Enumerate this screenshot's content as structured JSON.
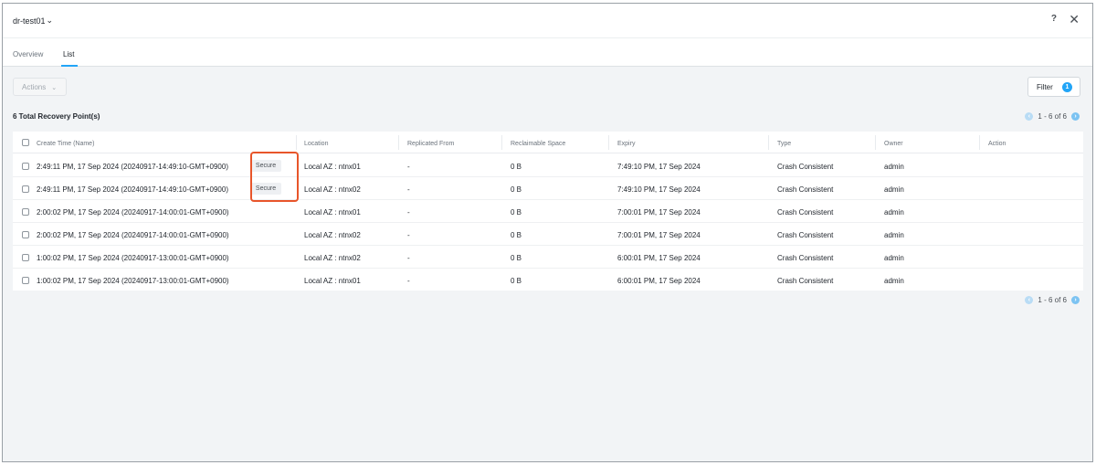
{
  "header": {
    "title": "dr-test01",
    "caret": "⌄",
    "help": "?",
    "close": "✕"
  },
  "tabs": [
    {
      "label": "Overview",
      "active": false
    },
    {
      "label": "List",
      "active": true
    }
  ],
  "toolbar": {
    "actions_label": "Actions",
    "filter_label": "Filter",
    "filter_count": "1"
  },
  "summary": {
    "count_label": "6 Total Recovery Point(s)"
  },
  "pager": {
    "top": "1 - 6 of 6",
    "bottom": "1 - 6 of 6"
  },
  "columns": [
    "Create Time (Name)",
    "Location",
    "Replicated From",
    "Reclaimable Space",
    "Expiry",
    "Type",
    "Owner",
    "Action"
  ],
  "rows": [
    {
      "create": "2:49:11 PM, 17 Sep 2024 (20240917-14:49:10-GMT+0900)",
      "badge": "Secure",
      "location": "Local AZ : ntnx01",
      "replicated": "-",
      "space": "0 B",
      "expiry": "7:49:10 PM, 17 Sep 2024",
      "type": "Crash Consistent",
      "owner": "admin"
    },
    {
      "create": "2:49:11 PM, 17 Sep 2024 (20240917-14:49:10-GMT+0900)",
      "badge": "Secure",
      "location": "Local AZ : ntnx02",
      "replicated": "-",
      "space": "0 B",
      "expiry": "7:49:10 PM, 17 Sep 2024",
      "type": "Crash Consistent",
      "owner": "admin"
    },
    {
      "create": "2:00:02 PM, 17 Sep 2024 (20240917-14:00:01-GMT+0900)",
      "badge": "",
      "location": "Local AZ : ntnx01",
      "replicated": "-",
      "space": "0 B",
      "expiry": "7:00:01 PM, 17 Sep 2024",
      "type": "Crash Consistent",
      "owner": "admin"
    },
    {
      "create": "2:00:02 PM, 17 Sep 2024 (20240917-14:00:01-GMT+0900)",
      "badge": "",
      "location": "Local AZ : ntnx02",
      "replicated": "-",
      "space": "0 B",
      "expiry": "7:00:01 PM, 17 Sep 2024",
      "type": "Crash Consistent",
      "owner": "admin"
    },
    {
      "create": "1:00:02 PM, 17 Sep 2024 (20240917-13:00:01-GMT+0900)",
      "badge": "",
      "location": "Local AZ : ntnx02",
      "replicated": "-",
      "space": "0 B",
      "expiry": "6:00:01 PM, 17 Sep 2024",
      "type": "Crash Consistent",
      "owner": "admin"
    },
    {
      "create": "1:00:02 PM, 17 Sep 2024 (20240917-13:00:01-GMT+0900)",
      "badge": "",
      "location": "Local AZ : ntnx01",
      "replicated": "-",
      "space": "0 B",
      "expiry": "6:00:01 PM, 17 Sep 2024",
      "type": "Crash Consistent",
      "owner": "admin"
    }
  ],
  "colors": {
    "accent": "#22a5f7",
    "highlight": "#e8552a"
  }
}
